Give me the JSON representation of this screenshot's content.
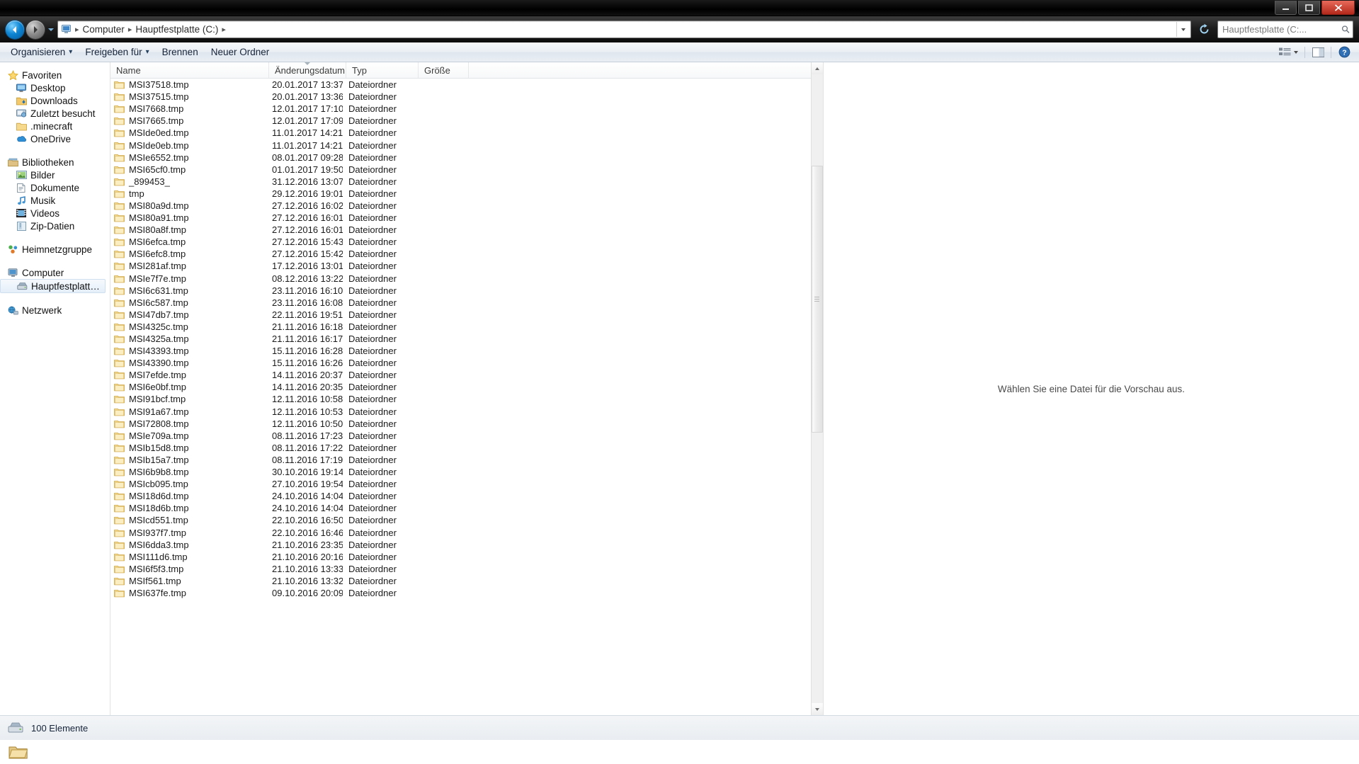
{
  "window": {
    "minimize_label": "—",
    "maximize_label": "□",
    "close_label": "✕"
  },
  "address": {
    "computer_crumb": "Computer",
    "drive_crumb": "Hauptfestplatte (C:)",
    "sep": "▸",
    "search_placeholder": "Hauptfestplatte (C:..."
  },
  "toolbar": {
    "organize": "Organisieren",
    "share": "Freigeben für",
    "burn": "Brennen",
    "new_folder": "Neuer Ordner",
    "dropdown_glyph": "▾"
  },
  "sidebar": {
    "favorites": {
      "label": "Favoriten",
      "icon": "star-icon",
      "items": [
        {
          "label": "Desktop",
          "icon": "desktop-icon"
        },
        {
          "label": "Downloads",
          "icon": "downloads-icon"
        },
        {
          "label": "Zuletzt besucht",
          "icon": "recent-places-icon"
        },
        {
          "label": ".minecraft",
          "icon": "folder-icon"
        },
        {
          "label": "OneDrive",
          "icon": "onedrive-icon"
        }
      ]
    },
    "libraries": {
      "label": "Bibliotheken",
      "icon": "libraries-icon",
      "items": [
        {
          "label": "Bilder",
          "icon": "pictures-icon"
        },
        {
          "label": "Dokumente",
          "icon": "documents-icon"
        },
        {
          "label": "Musik",
          "icon": "music-icon"
        },
        {
          "label": "Videos",
          "icon": "videos-icon"
        },
        {
          "label": "Zip-Datien",
          "icon": "zip-icon"
        }
      ]
    },
    "homegroup": {
      "label": "Heimnetzgruppe",
      "icon": "homegroup-icon"
    },
    "computer": {
      "label": "Computer",
      "icon": "computer-icon",
      "items": [
        {
          "label": "Hauptfestplatte (C:)",
          "icon": "harddisk-icon",
          "selected": true
        }
      ]
    },
    "network": {
      "label": "Netzwerk",
      "icon": "network-icon"
    }
  },
  "columns": [
    {
      "key": "name",
      "label": "Name",
      "sorted": false
    },
    {
      "key": "date",
      "label": "Änderungsdatum",
      "sorted": true
    },
    {
      "key": "type",
      "label": "Typ",
      "sorted": false
    },
    {
      "key": "size",
      "label": "Größe",
      "sorted": false
    }
  ],
  "files": [
    {
      "name": "MSI37518.tmp",
      "date": "20.01.2017 13:37",
      "type": "Dateiordner",
      "size": ""
    },
    {
      "name": "MSI37515.tmp",
      "date": "20.01.2017 13:36",
      "type": "Dateiordner",
      "size": ""
    },
    {
      "name": "MSI7668.tmp",
      "date": "12.01.2017 17:10",
      "type": "Dateiordner",
      "size": ""
    },
    {
      "name": "MSI7665.tmp",
      "date": "12.01.2017 17:09",
      "type": "Dateiordner",
      "size": ""
    },
    {
      "name": "MSIde0ed.tmp",
      "date": "11.01.2017 14:21",
      "type": "Dateiordner",
      "size": ""
    },
    {
      "name": "MSIde0eb.tmp",
      "date": "11.01.2017 14:21",
      "type": "Dateiordner",
      "size": ""
    },
    {
      "name": "MSIe6552.tmp",
      "date": "08.01.2017 09:28",
      "type": "Dateiordner",
      "size": ""
    },
    {
      "name": "MSI65cf0.tmp",
      "date": "01.01.2017 19:50",
      "type": "Dateiordner",
      "size": ""
    },
    {
      "name": "_899453_",
      "date": "31.12.2016 13:07",
      "type": "Dateiordner",
      "size": ""
    },
    {
      "name": "tmp",
      "date": "29.12.2016 19:01",
      "type": "Dateiordner",
      "size": ""
    },
    {
      "name": "MSI80a9d.tmp",
      "date": "27.12.2016 16:02",
      "type": "Dateiordner",
      "size": ""
    },
    {
      "name": "MSI80a91.tmp",
      "date": "27.12.2016 16:01",
      "type": "Dateiordner",
      "size": ""
    },
    {
      "name": "MSI80a8f.tmp",
      "date": "27.12.2016 16:01",
      "type": "Dateiordner",
      "size": ""
    },
    {
      "name": "MSI6efca.tmp",
      "date": "27.12.2016 15:43",
      "type": "Dateiordner",
      "size": ""
    },
    {
      "name": "MSI6efc8.tmp",
      "date": "27.12.2016 15:42",
      "type": "Dateiordner",
      "size": ""
    },
    {
      "name": "MSI281af.tmp",
      "date": "17.12.2016 13:01",
      "type": "Dateiordner",
      "size": ""
    },
    {
      "name": "MSIe7f7e.tmp",
      "date": "08.12.2016 13:22",
      "type": "Dateiordner",
      "size": ""
    },
    {
      "name": "MSI6c631.tmp",
      "date": "23.11.2016 16:10",
      "type": "Dateiordner",
      "size": ""
    },
    {
      "name": "MSI6c587.tmp",
      "date": "23.11.2016 16:08",
      "type": "Dateiordner",
      "size": ""
    },
    {
      "name": "MSI47db7.tmp",
      "date": "22.11.2016 19:51",
      "type": "Dateiordner",
      "size": ""
    },
    {
      "name": "MSI4325c.tmp",
      "date": "21.11.2016 16:18",
      "type": "Dateiordner",
      "size": ""
    },
    {
      "name": "MSI4325a.tmp",
      "date": "21.11.2016 16:17",
      "type": "Dateiordner",
      "size": ""
    },
    {
      "name": "MSI43393.tmp",
      "date": "15.11.2016 16:28",
      "type": "Dateiordner",
      "size": ""
    },
    {
      "name": "MSI43390.tmp",
      "date": "15.11.2016 16:26",
      "type": "Dateiordner",
      "size": ""
    },
    {
      "name": "MSI7efde.tmp",
      "date": "14.11.2016 20:37",
      "type": "Dateiordner",
      "size": ""
    },
    {
      "name": "MSI6e0bf.tmp",
      "date": "14.11.2016 20:35",
      "type": "Dateiordner",
      "size": ""
    },
    {
      "name": "MSI91bcf.tmp",
      "date": "12.11.2016 10:58",
      "type": "Dateiordner",
      "size": ""
    },
    {
      "name": "MSI91a67.tmp",
      "date": "12.11.2016 10:53",
      "type": "Dateiordner",
      "size": ""
    },
    {
      "name": "MSI72808.tmp",
      "date": "12.11.2016 10:50",
      "type": "Dateiordner",
      "size": ""
    },
    {
      "name": "MSIe709a.tmp",
      "date": "08.11.2016 17:23",
      "type": "Dateiordner",
      "size": ""
    },
    {
      "name": "MSIb15d8.tmp",
      "date": "08.11.2016 17:22",
      "type": "Dateiordner",
      "size": ""
    },
    {
      "name": "MSIb15a7.tmp",
      "date": "08.11.2016 17:19",
      "type": "Dateiordner",
      "size": ""
    },
    {
      "name": "MSI6b9b8.tmp",
      "date": "30.10.2016 19:14",
      "type": "Dateiordner",
      "size": ""
    },
    {
      "name": "MSIcb095.tmp",
      "date": "27.10.2016 19:54",
      "type": "Dateiordner",
      "size": ""
    },
    {
      "name": "MSI18d6d.tmp",
      "date": "24.10.2016 14:04",
      "type": "Dateiordner",
      "size": ""
    },
    {
      "name": "MSI18d6b.tmp",
      "date": "24.10.2016 14:04",
      "type": "Dateiordner",
      "size": ""
    },
    {
      "name": "MSIcd551.tmp",
      "date": "22.10.2016 16:50",
      "type": "Dateiordner",
      "size": ""
    },
    {
      "name": "MSI937f7.tmp",
      "date": "22.10.2016 16:46",
      "type": "Dateiordner",
      "size": ""
    },
    {
      "name": "MSI6dda3.tmp",
      "date": "21.10.2016 23:35",
      "type": "Dateiordner",
      "size": ""
    },
    {
      "name": "MSI111d6.tmp",
      "date": "21.10.2016 20:16",
      "type": "Dateiordner",
      "size": ""
    },
    {
      "name": "MSI6f5f3.tmp",
      "date": "21.10.2016 13:33",
      "type": "Dateiordner",
      "size": ""
    },
    {
      "name": "MSIf561.tmp",
      "date": "21.10.2016 13:32",
      "type": "Dateiordner",
      "size": ""
    },
    {
      "name": "MSI637fe.tmp",
      "date": "09.10.2016 20:09",
      "type": "Dateiordner",
      "size": ""
    }
  ],
  "preview": {
    "empty_message": "Wählen Sie eine Datei für die Vorschau aus."
  },
  "status": {
    "item_count": "100 Elemente"
  }
}
